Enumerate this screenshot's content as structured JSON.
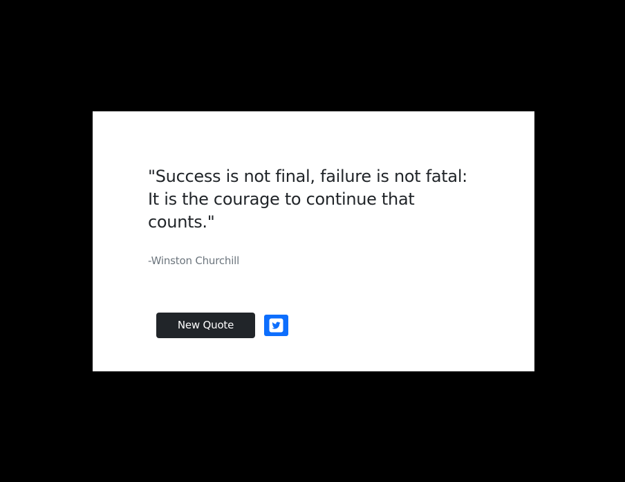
{
  "quote": {
    "text": "\"Success is not final, failure is not fatal: It is the courage to continue that counts.\"",
    "author": "-Winston Churchill"
  },
  "actions": {
    "new_quote_label": "New Quote",
    "tweet_icon": "twitter-icon"
  },
  "colors": {
    "page_background": "#000000",
    "card_background": "#ffffff",
    "quote_text": "#212529",
    "author_text": "#6c757d",
    "new_quote_button": "#212529",
    "tweet_button": "#0d6efd"
  }
}
